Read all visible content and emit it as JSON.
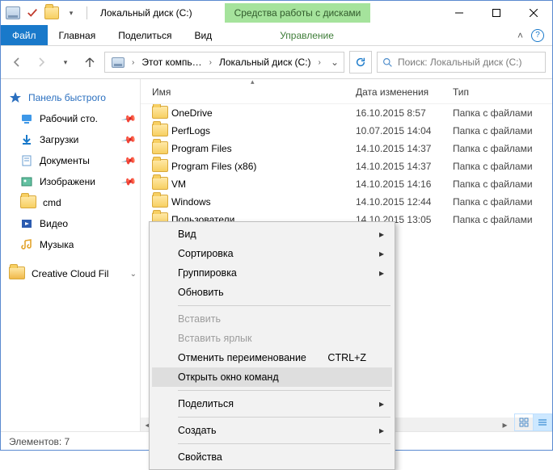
{
  "title": "Локальный диск (C:)",
  "disktools_tab": "Средства работы с дисками",
  "ribbon": {
    "file": "Файл",
    "home": "Главная",
    "share": "Поделиться",
    "view": "Вид",
    "management": "Управление"
  },
  "breadcrumb": {
    "seg1": "Этот компь…",
    "seg2": "Локальный диск (C:)"
  },
  "search": {
    "placeholder": "Поиск: Локальный диск (C:)"
  },
  "sidebar": {
    "quickaccess": "Панель быстрого",
    "items": [
      {
        "label": "Рабочий сто.",
        "icon": "desktop",
        "pin": true
      },
      {
        "label": "Загрузки",
        "icon": "downloads",
        "pin": true
      },
      {
        "label": "Документы",
        "icon": "documents",
        "pin": true
      },
      {
        "label": "Изображени",
        "icon": "pictures",
        "pin": true
      },
      {
        "label": "cmd",
        "icon": "folder",
        "pin": false
      },
      {
        "label": "Видео",
        "icon": "videos",
        "pin": false
      },
      {
        "label": "Музыка",
        "icon": "music",
        "pin": false
      }
    ],
    "ccf": "Creative Cloud Fil"
  },
  "columns": {
    "name": "Имя",
    "date": "Дата изменения",
    "type": "Тип"
  },
  "folder_type": "Папка с файлами",
  "rows": [
    {
      "name": "OneDrive",
      "date": "16.10.2015 8:57"
    },
    {
      "name": "PerfLogs",
      "date": "10.07.2015 14:04"
    },
    {
      "name": "Program Files",
      "date": "14.10.2015 14:37"
    },
    {
      "name": "Program Files (x86)",
      "date": "14.10.2015 14:37"
    },
    {
      "name": "VM",
      "date": "14.10.2015 14:16"
    },
    {
      "name": "Windows",
      "date": "14.10.2015 12:44"
    },
    {
      "name": "Пользователи",
      "date": "14.10.2015 13:05"
    }
  ],
  "status": "Элементов: 7",
  "ctx": {
    "view": "Вид",
    "sort": "Сортировка",
    "group": "Группировка",
    "refresh": "Обновить",
    "paste": "Вставить",
    "paste_sc": "Вставить ярлык",
    "undo": "Отменить переименование",
    "undo_sc": "CTRL+Z",
    "opencmd": "Открыть окно команд",
    "share": "Поделиться",
    "new": "Создать",
    "props": "Свойства"
  }
}
